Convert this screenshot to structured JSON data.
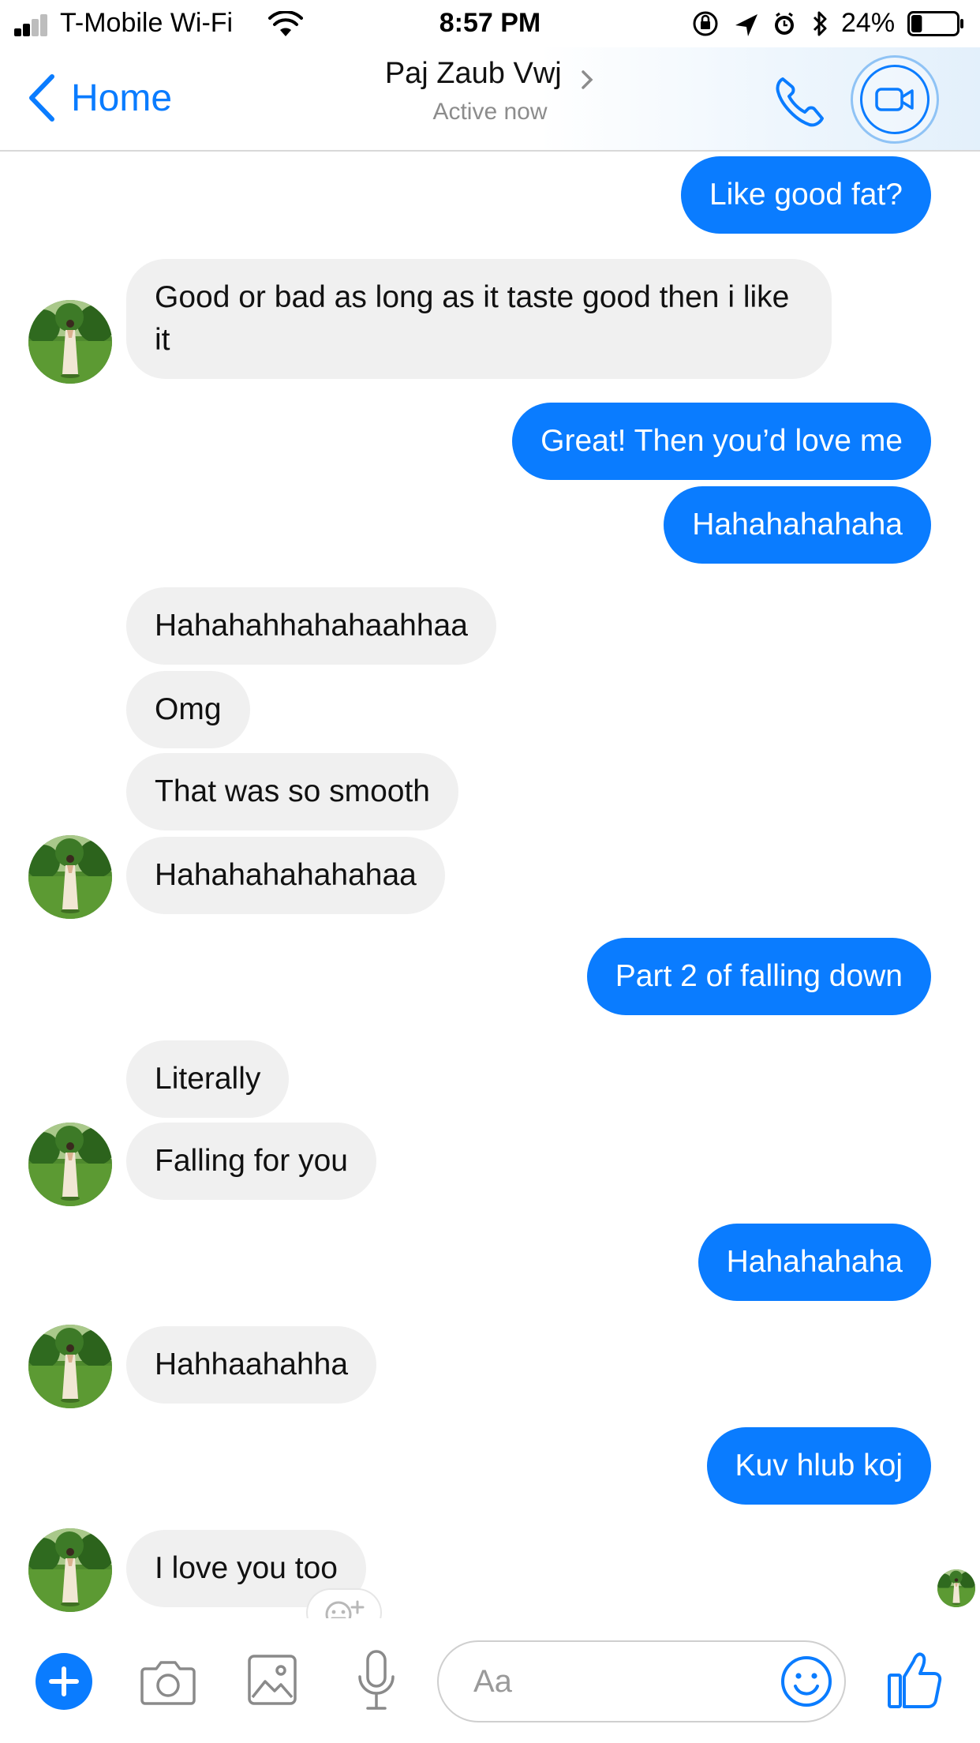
{
  "status_bar": {
    "carrier": "T-Mobile Wi-Fi",
    "time": "8:57 PM",
    "battery_percent": "24%",
    "battery_level": 0.24,
    "icons": [
      "signal-icon",
      "wifi-icon",
      "orientation-lock-icon",
      "location-icon",
      "alarm-icon",
      "bluetooth-icon",
      "battery-icon"
    ]
  },
  "header": {
    "back_label": "Home",
    "contact_name": "Paj Zaub Vwj",
    "contact_status": "Active now",
    "icons": [
      "chevron-left-icon",
      "chevron-right-icon",
      "phone-icon",
      "video-camera-icon"
    ]
  },
  "messages": [
    {
      "side": "out",
      "text": "Like good fat?"
    },
    {
      "side": "in",
      "text": "Good or bad as long as it taste good then i like it"
    },
    {
      "side": "out",
      "text": "Great! Then you’d love me"
    },
    {
      "side": "out",
      "text": "Hahahahahaha"
    },
    {
      "side": "in",
      "text": "Hahahahhahahaahhaa"
    },
    {
      "side": "in",
      "text": "Omg"
    },
    {
      "side": "in",
      "text": "That was so smooth"
    },
    {
      "side": "in",
      "text": "Hahahahahahahaa"
    },
    {
      "side": "out",
      "text": "Part 2 of falling down"
    },
    {
      "side": "in",
      "text": "Literally"
    },
    {
      "side": "in",
      "text": "Falling for you"
    },
    {
      "side": "out",
      "text": "Hahahahaha"
    },
    {
      "side": "in",
      "text": "Hahhaahahha"
    },
    {
      "side": "out",
      "text": "Kuv hlub koj"
    },
    {
      "side": "in",
      "text": "I love you too"
    }
  ],
  "composer": {
    "placeholder": "Aa",
    "icons": [
      "plus-icon",
      "camera-icon",
      "image-icon",
      "microphone-icon",
      "emoji-icon",
      "thumbs-up-icon"
    ]
  },
  "colors": {
    "accent": "#0a7cff",
    "incoming_bubble": "#f0f0f0",
    "outgoing_text": "#ffffff",
    "incoming_text": "#111111",
    "secondary_text": "#8c8c8c"
  }
}
